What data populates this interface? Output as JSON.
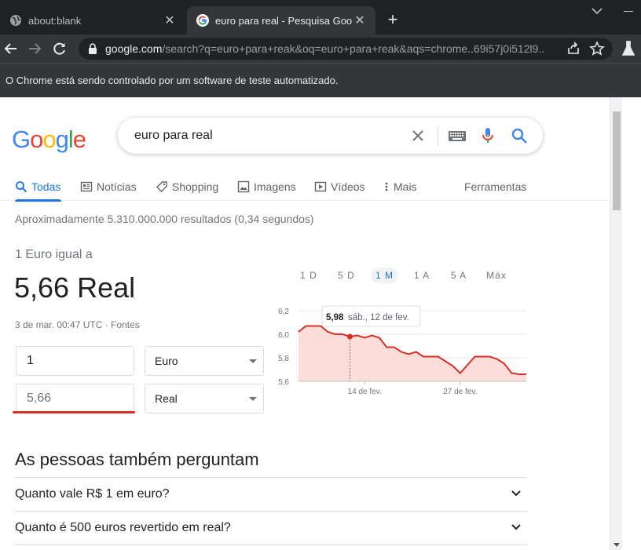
{
  "browser": {
    "tabs": [
      {
        "title": "about:blank",
        "active": false
      },
      {
        "title": "euro para real - Pesquisa Google",
        "active": true
      }
    ],
    "new_tab": "+",
    "url_host": "google.com",
    "url_path": "/search?q=euro+para+reak&oq=euro+para+reak&aqs=chrome..69i57j0i512l9....",
    "automation_notice": "O Chrome está sendo controlado por um software de teste automatizado."
  },
  "google": {
    "logo": {
      "letters": [
        "G",
        "o",
        "o",
        "g",
        "l",
        "e"
      ],
      "colors": [
        "#4285f4",
        "#ea4335",
        "#fbbc05",
        "#4285f4",
        "#34a853",
        "#ea4335"
      ]
    },
    "query": "euro para real",
    "tabs": [
      "Todas",
      "Notícias",
      "Shopping",
      "Imagens",
      "Vídeos",
      "Mais"
    ],
    "tools": "Ferramentas",
    "stats": "Aproximadamente 5.310.000.000 resultados (0,34 segundos)"
  },
  "converter": {
    "label": "1 Euro igual a",
    "value": "5,66 Real",
    "date": "3 de mar. 00:47 UTC · Fontes",
    "from_amount": "1",
    "from_currency": "Euro",
    "to_amount": "5,66",
    "to_currency": "Real",
    "ranges": [
      "1 D",
      "5 D",
      "1 M",
      "1 A",
      "5 A",
      "Máx"
    ],
    "active_range": "1 M",
    "tooltip_value": "5,98",
    "tooltip_date": "sáb., 12 de fev."
  },
  "chart_data": {
    "type": "area",
    "title": "",
    "xlabel": "",
    "ylabel": "",
    "ylim": [
      5.6,
      6.2
    ],
    "yticks": [
      "5,6",
      "5,8",
      "6,0",
      "6,2"
    ],
    "xticks": [
      "14 de fev.",
      "27 de fev."
    ],
    "series": [
      {
        "values": [
          6.02,
          6.07,
          6.07,
          6.07,
          6.02,
          6.0,
          6.0,
          5.98,
          5.99,
          5.97,
          5.99,
          5.97,
          5.89,
          5.89,
          5.85,
          5.83,
          5.85,
          5.81,
          5.81,
          5.81,
          5.77,
          5.73,
          5.67,
          5.74,
          5.81,
          5.81,
          5.81,
          5.79,
          5.75,
          5.67,
          5.66,
          5.66
        ]
      }
    ],
    "highlight_index": 7,
    "colors": {
      "line": "#d93025",
      "fill": "#fbd5d1",
      "grid": "#e8eaed"
    }
  },
  "people_also_ask": {
    "title": "As pessoas também perguntam",
    "questions": [
      "Quanto vale R$ 1 em euro?",
      "Quanto é 500 euros revertido em real?"
    ]
  }
}
